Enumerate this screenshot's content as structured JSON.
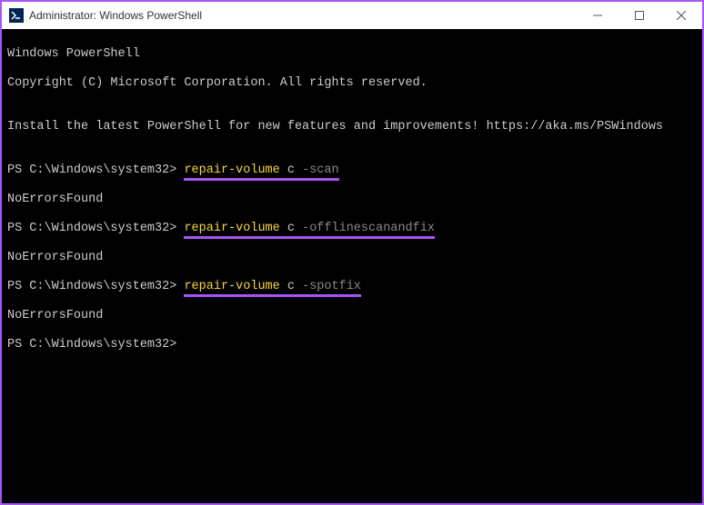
{
  "window": {
    "title": "Administrator: Windows PowerShell"
  },
  "header": {
    "line1": "Windows PowerShell",
    "line2": "Copyright (C) Microsoft Corporation. All rights reserved.",
    "install": "Install the latest PowerShell for new features and improvements! https://aka.ms/PSWindows"
  },
  "prompt": "PS C:\\Windows\\system32> ",
  "commands": [
    {
      "cmd": "repair-volume",
      "target": "c",
      "flag": "-scan",
      "result": "NoErrorsFound"
    },
    {
      "cmd": "repair-volume",
      "target": "c",
      "flag": "-offlinescanandfix",
      "result": "NoErrorsFound"
    },
    {
      "cmd": "repair-volume",
      "target": "c",
      "flag": "-spotfix",
      "result": "NoErrorsFound"
    }
  ],
  "colors": {
    "accent": "#a855f7",
    "cmd_yellow": "#f5d742",
    "flag_gray": "#888888",
    "text": "#cccccc",
    "bg": "#000000"
  }
}
